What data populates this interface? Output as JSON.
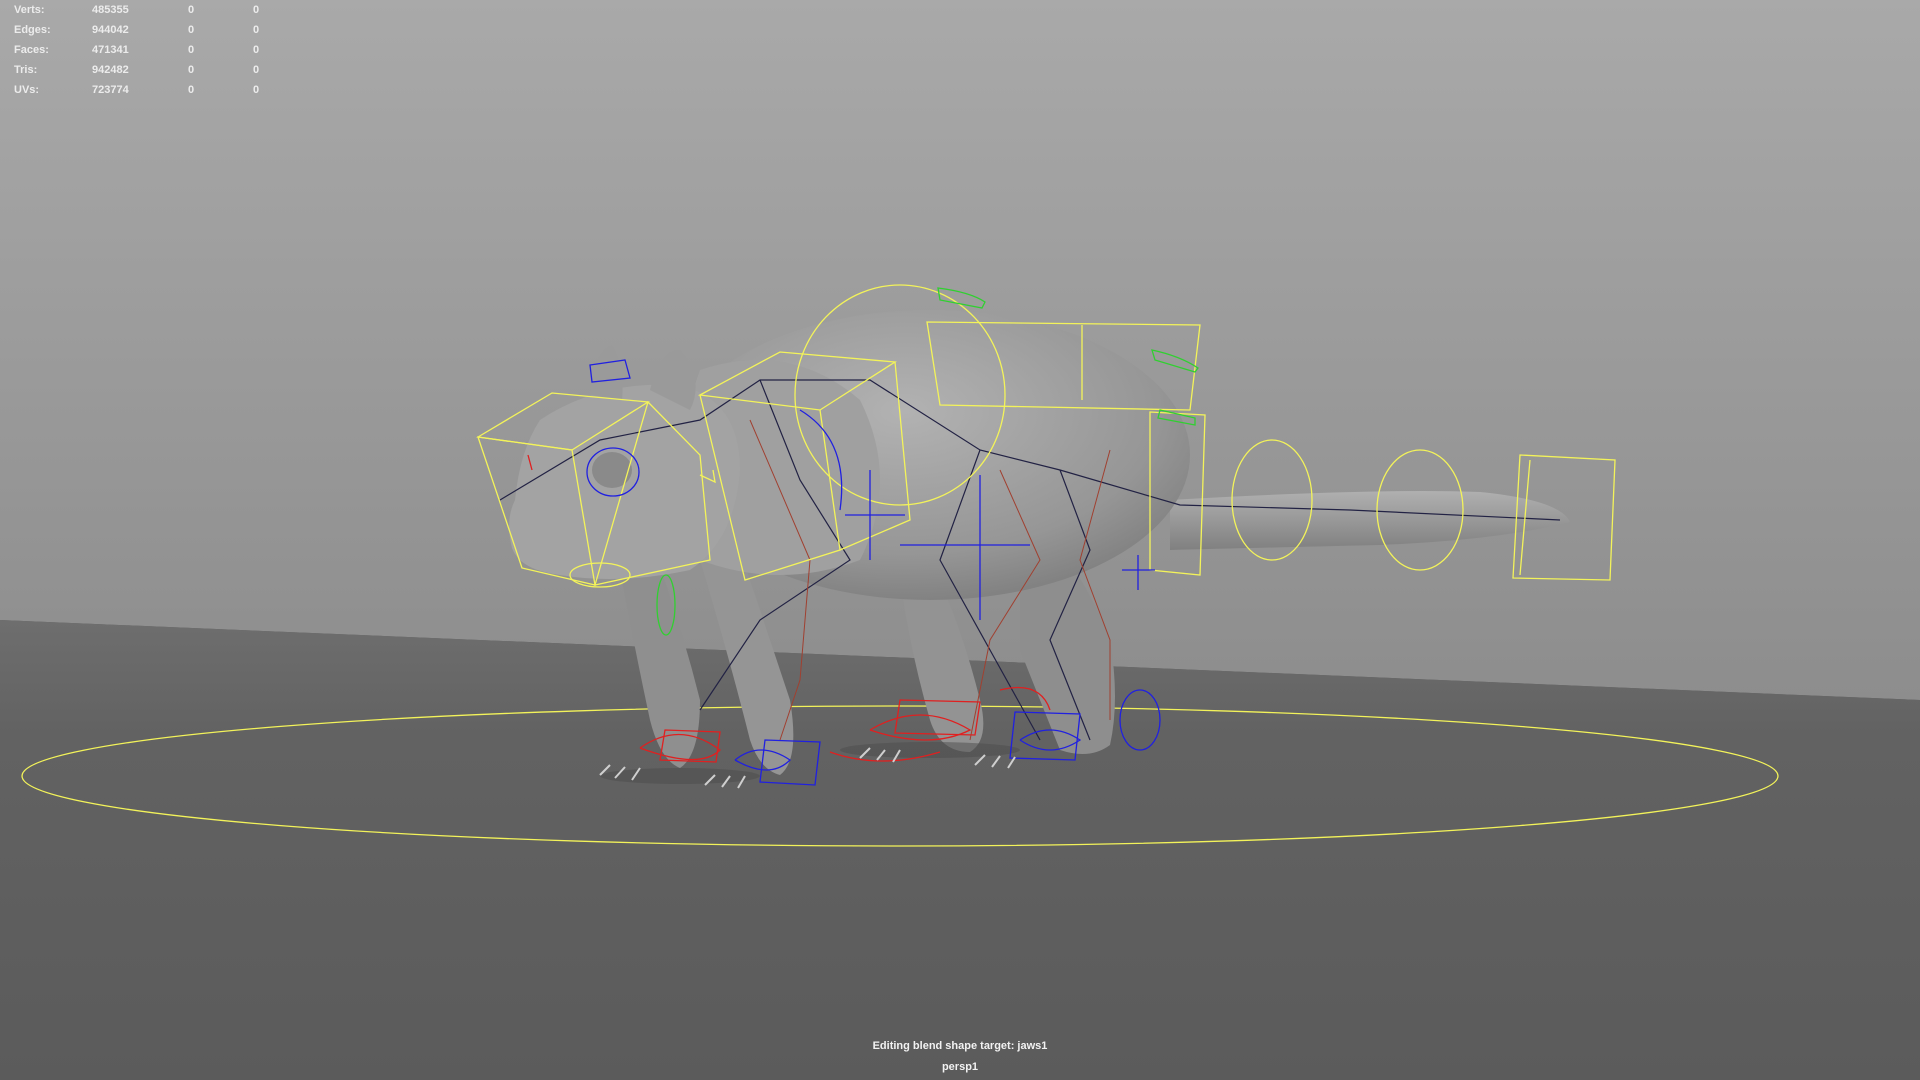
{
  "hud": {
    "rows": [
      {
        "label": "Verts:",
        "v1": "485355",
        "v2": "0",
        "v3": "0"
      },
      {
        "label": "Edges:",
        "v1": "944042",
        "v2": "0",
        "v3": "0"
      },
      {
        "label": "Faces:",
        "v1": "471341",
        "v2": "0",
        "v3": "0"
      },
      {
        "label": "Tris:",
        "v1": "942482",
        "v2": "0",
        "v3": "0"
      },
      {
        "label": "UVs:",
        "v1": "723774",
        "v2": "0",
        "v3": "0"
      }
    ]
  },
  "status": {
    "blend_message": "Editing blend shape target: jaws1",
    "camera": "persp1"
  },
  "colors": {
    "bg_top": "#a8a8a8",
    "bg_floor": "#5e5e5e",
    "model": "#9a9a9a",
    "ctrl_yellow": "#f3f35a",
    "ctrl_red": "#e02020",
    "ctrl_blue": "#2020e0",
    "ctrl_green": "#30d030",
    "joint": "#222244",
    "bone_red": "#a04030"
  },
  "icons": {
    "hud": "stats-overlay",
    "model": "rat-rig-model"
  }
}
